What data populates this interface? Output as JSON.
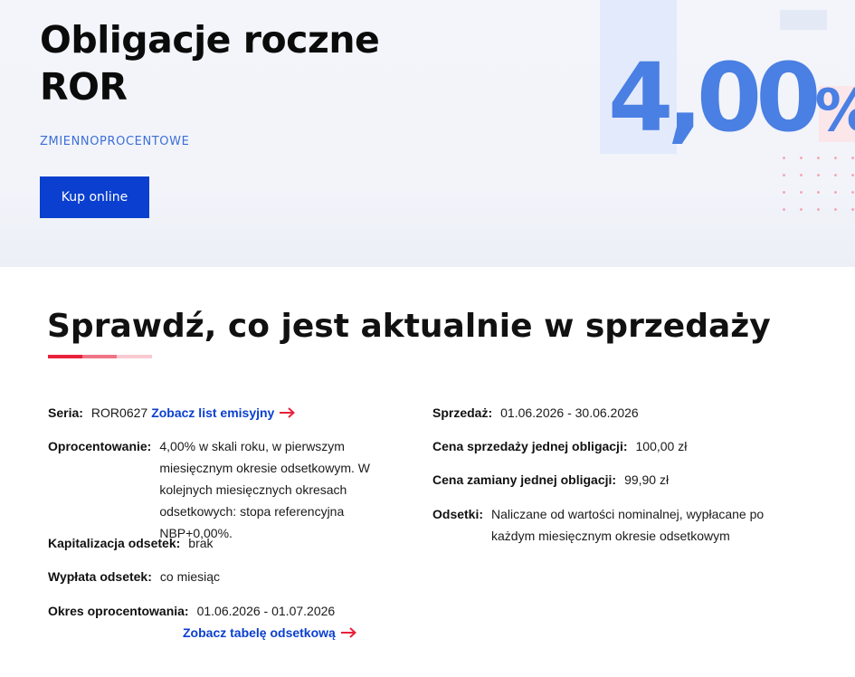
{
  "hero": {
    "title": "Obligacje roczne ROR",
    "subtitle": "ZMIENNOPROCENTOWE",
    "buy_label": "Kup online",
    "rate_value": "4,00",
    "rate_symbol": "%"
  },
  "section": {
    "title": "Sprawdź, co jest aktualnie w sprzedaży"
  },
  "left": {
    "series_label": "Seria:",
    "series_value": "ROR0627",
    "series_link": "Zobacz list emisyjny",
    "interest_label": "Oprocentowanie:",
    "interest_value": "4,00% w skali roku, w pierwszym miesięcznym okresie odsetkowym. W kolejnych miesięcznych okresach odsetkowych: stopa referencyjna NBP+0,00%.",
    "cap_label": "Kapitalizacja odsetek:",
    "cap_value": "brak",
    "payout_label": "Wypłata odsetek:",
    "payout_value": "co miesiąc",
    "period_label": "Okres oprocentowania:",
    "period_value": "01.06.2026 - 01.07.2026",
    "table_link": "Zobacz tabelę odsetkową"
  },
  "right": {
    "sale_label": "Sprzedaż:",
    "sale_value": "01.06.2026 - 30.06.2026",
    "price_label": "Cena sprzedaży jednej obligacji:",
    "price_value": "100,00 zł",
    "exchange_label": "Cena zamiany jednej obligacji:",
    "exchange_value": "99,90 zł",
    "interest_label": "Odsetki:",
    "interest_value": "Naliczane od wartości nominalnej, wypłacane po każdym miesięcznym okresie odsetkowym"
  },
  "colors": {
    "primary": "#0a3fcf",
    "accent_red": "#e8213b",
    "rate_blue": "#4a7fe3"
  }
}
